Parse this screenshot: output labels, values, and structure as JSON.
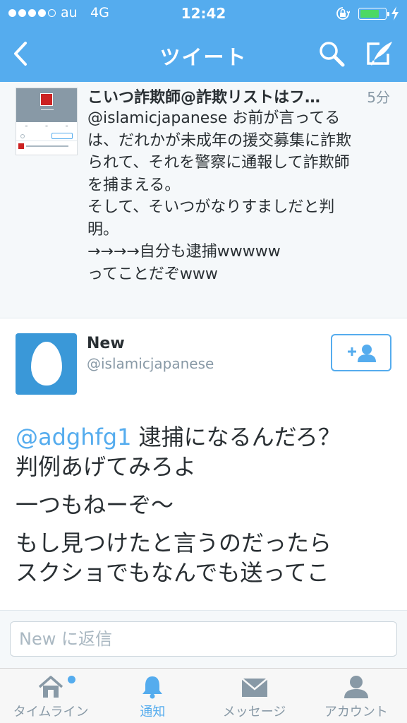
{
  "status_bar": {
    "carrier": "au",
    "network": "4G",
    "time": "12:42",
    "battery_level": 0.8
  },
  "nav": {
    "title": "ツイート",
    "icons": [
      "back-icon",
      "search-icon",
      "compose-icon"
    ]
  },
  "quoted_tweet": {
    "author": "こいつ詐欺師@詐欺リストはフ…",
    "time": "5分",
    "text": "@islamicjapanese お前が言ってる\nは、だれかが未成年の援交募集に詐欺\nられて、それを警察に通報して詐欺師\nを捕まえる。\nそして、そいつがなりすましだと判\n明。\n→→→→自分も逮捕wwwww\nってことだぞwww"
  },
  "tweet": {
    "name": "New",
    "handle": "@islamicjapanese",
    "mention": "@adghfg1",
    "line1_rest": " 逮捕になるんだろ？",
    "line2": "判例あげてみろよ",
    "para2": "一つもねーぞ〜",
    "para3_line1": "もし見つけたと言うのだったら",
    "para3_line2": "スクショでもなんでも送ってこ"
  },
  "reply": {
    "placeholder": "New に返信"
  },
  "tabs": [
    {
      "label": "タイムライン",
      "icon": "home-icon",
      "active": false,
      "badge": true
    },
    {
      "label": "通知",
      "icon": "bell-icon",
      "active": true,
      "badge": false
    },
    {
      "label": "メッセージ",
      "icon": "envelope-icon",
      "active": false,
      "badge": false
    },
    {
      "label": "アカウント",
      "icon": "person-icon",
      "active": false,
      "badge": false
    }
  ],
  "colors": {
    "brand": "#55acee",
    "text": "#292f33",
    "muted": "#8899a6"
  }
}
